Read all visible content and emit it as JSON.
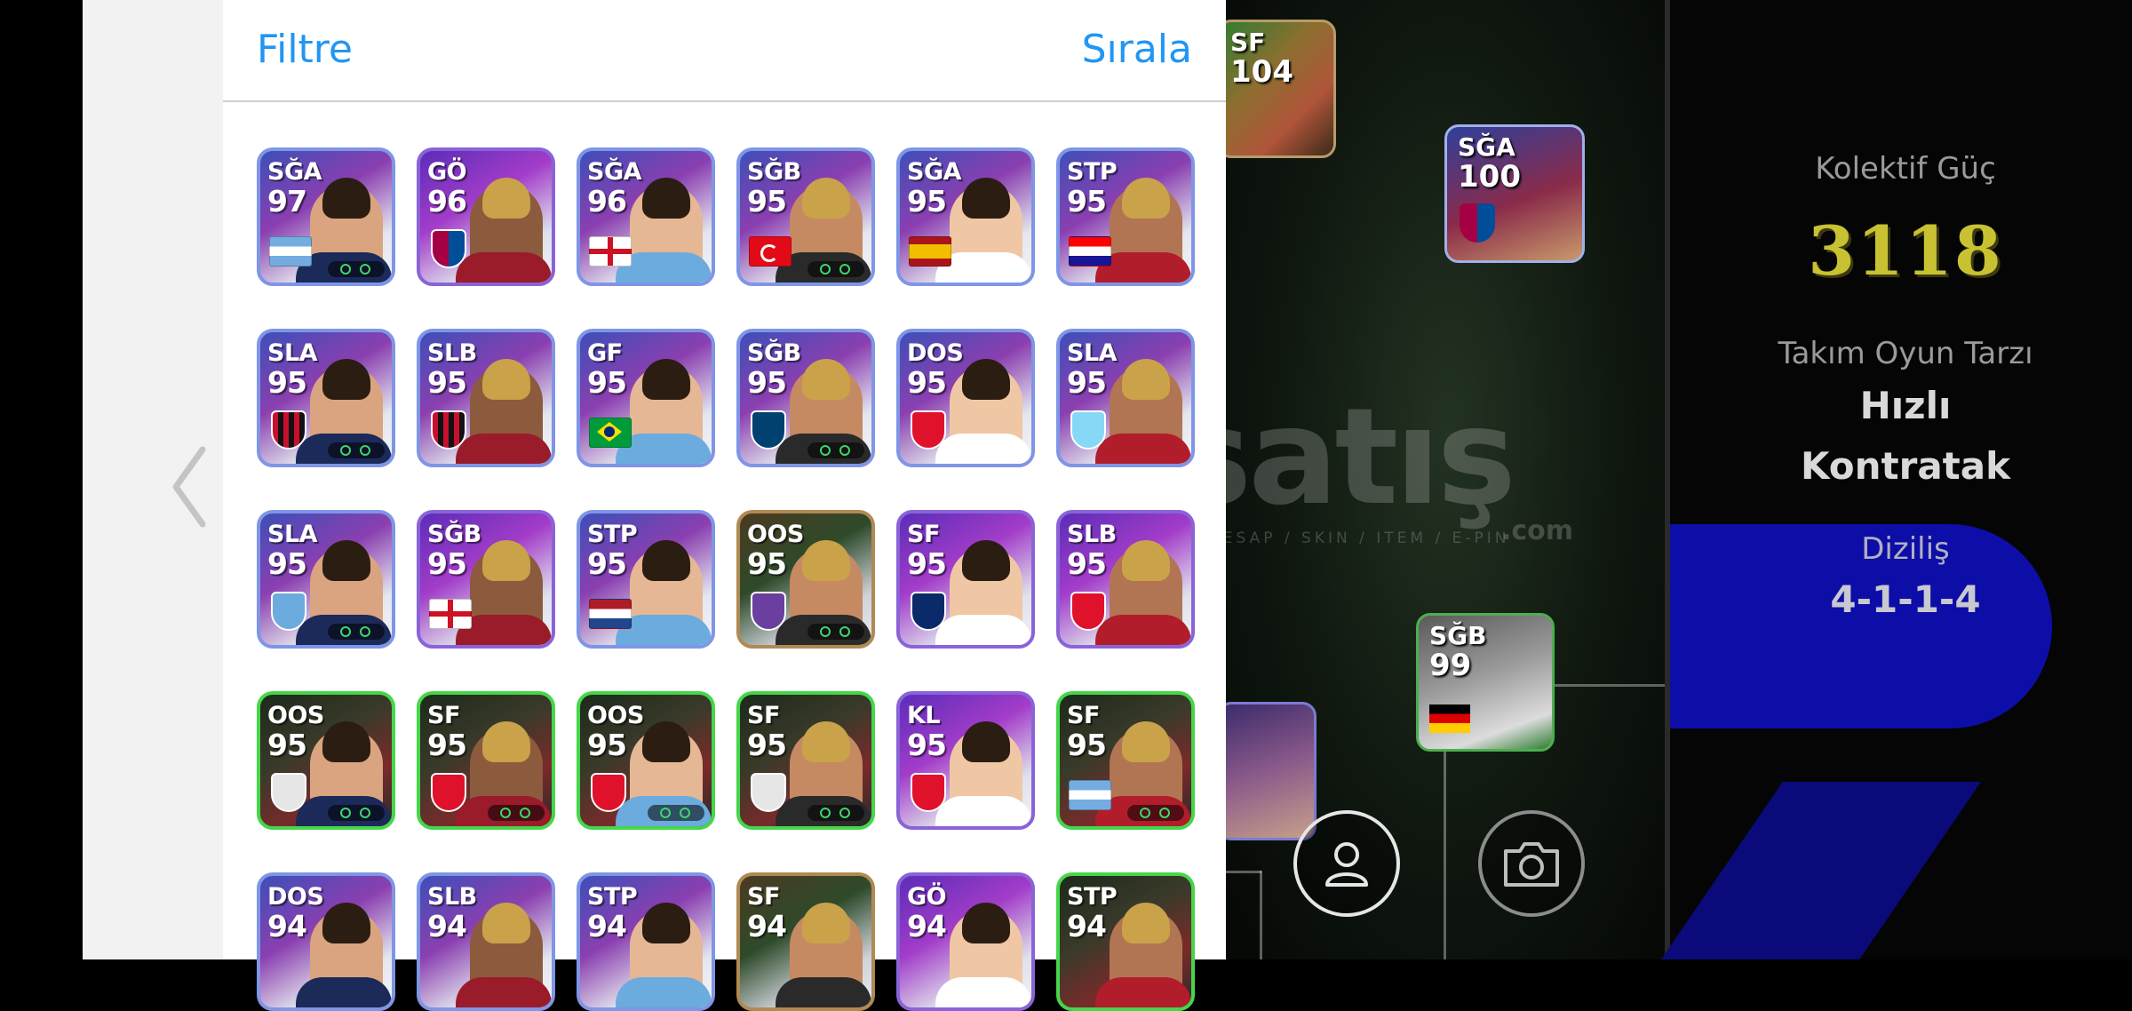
{
  "modal": {
    "filter_label": "Filtre",
    "sort_label": "Sırala"
  },
  "colors": {
    "accent": "#2196f3",
    "team_power": "#c8c232",
    "formation_pill": "#0d0da8"
  },
  "team_info": {
    "team_power_label": "Kolektif Güç",
    "team_power_value": "3118",
    "playstyle_label": "Takım Oyun Tarzı",
    "playstyle_line1": "Hızlı",
    "playstyle_line2": "Kontratak",
    "formation_label": "Diziliş",
    "formation_value": "4-1-1-4"
  },
  "watermark": {
    "main": "satış",
    "suffix": ".com",
    "sub": "HESAP / SKIN / ITEM / E-PIN"
  },
  "pitch_cards": [
    {
      "pos": "SF",
      "rating": "104"
    },
    {
      "pos": "SĞA",
      "rating": "100"
    },
    {
      "pos": "SĞB",
      "rating": "99"
    },
    {
      "pos": "",
      "rating": ""
    }
  ],
  "players": [
    {
      "pos": "SĞA",
      "rating": "97",
      "flag": "argentina",
      "style": "blue"
    },
    {
      "pos": "GÖ",
      "rating": "96",
      "flag": "club-barcelona",
      "style": "purple"
    },
    {
      "pos": "SĞA",
      "rating": "96",
      "flag": "england",
      "style": "blue"
    },
    {
      "pos": "SĞB",
      "rating": "95",
      "flag": "turkey",
      "style": "blue"
    },
    {
      "pos": "SĞA",
      "rating": "95",
      "flag": "spain",
      "style": "blue"
    },
    {
      "pos": "STP",
      "rating": "95",
      "flag": "croatia",
      "style": "blue"
    },
    {
      "pos": "SLA",
      "rating": "95",
      "flag": "club-milan",
      "style": "blue"
    },
    {
      "pos": "SLB",
      "rating": "95",
      "flag": "club-milan",
      "style": "blue"
    },
    {
      "pos": "GF",
      "rating": "95",
      "flag": "brazil",
      "style": "blue"
    },
    {
      "pos": "SĞB",
      "rating": "95",
      "flag": "club-psg",
      "style": "blue"
    },
    {
      "pos": "DOS",
      "rating": "95",
      "flag": "club-red",
      "style": "blue"
    },
    {
      "pos": "SLA",
      "rating": "95",
      "flag": "club-lazio",
      "style": "blue"
    },
    {
      "pos": "SLA",
      "rating": "95",
      "flag": "club-city",
      "style": "blue"
    },
    {
      "pos": "SĞB",
      "rating": "95",
      "flag": "england",
      "style": "purple"
    },
    {
      "pos": "STP",
      "rating": "95",
      "flag": "netherlands",
      "style": "blue"
    },
    {
      "pos": "OOS",
      "rating": "95",
      "flag": "club-purple",
      "style": "gold"
    },
    {
      "pos": "SF",
      "rating": "95",
      "flag": "club-inter",
      "style": "purple"
    },
    {
      "pos": "SLB",
      "rating": "95",
      "flag": "club-red",
      "style": "purple"
    },
    {
      "pos": "OOS",
      "rating": "95",
      "flag": "club-grey",
      "style": "green"
    },
    {
      "pos": "SF",
      "rating": "95",
      "flag": "club-red",
      "style": "green"
    },
    {
      "pos": "OOS",
      "rating": "95",
      "flag": "club-red",
      "style": "green"
    },
    {
      "pos": "SF",
      "rating": "95",
      "flag": "club-grey",
      "style": "green"
    },
    {
      "pos": "KL",
      "rating": "95",
      "flag": "club-red",
      "style": "purple"
    },
    {
      "pos": "SF",
      "rating": "95",
      "flag": "argentina",
      "style": "green"
    },
    {
      "pos": "DOS",
      "rating": "94",
      "flag": "",
      "style": "blue"
    },
    {
      "pos": "SLB",
      "rating": "94",
      "flag": "",
      "style": "blue"
    },
    {
      "pos": "STP",
      "rating": "94",
      "flag": "",
      "style": "blue"
    },
    {
      "pos": "SF",
      "rating": "94",
      "flag": "",
      "style": "gold"
    },
    {
      "pos": "GÖ",
      "rating": "94",
      "flag": "",
      "style": "purple"
    },
    {
      "pos": "STP",
      "rating": "94",
      "flag": "",
      "style": "green"
    }
  ]
}
